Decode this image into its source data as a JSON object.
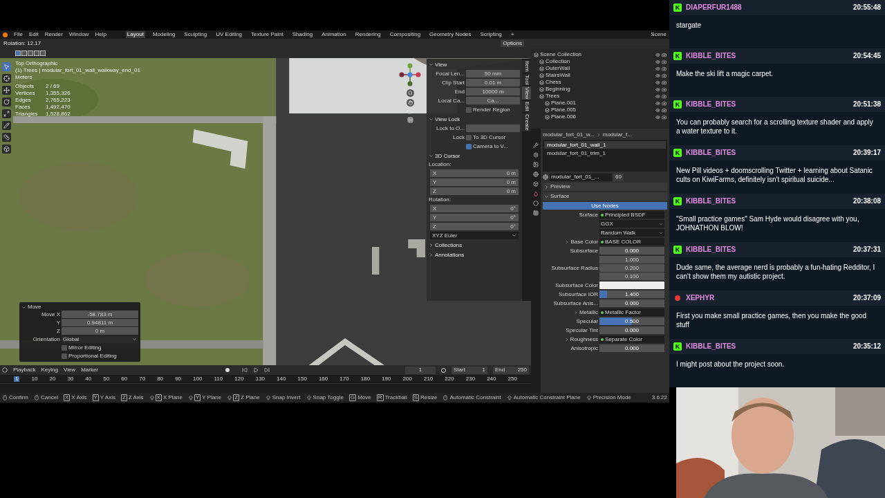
{
  "menu": [
    "File",
    "Edit",
    "Render",
    "Window",
    "Help"
  ],
  "workspaces": [
    {
      "label": "Layout",
      "selected": true
    },
    {
      "label": "Modeling",
      "selected": false
    },
    {
      "label": "Sculpting",
      "selected": false
    },
    {
      "label": "UV Editing",
      "selected": false
    },
    {
      "label": "Texture Paint",
      "selected": false
    },
    {
      "label": "Shading",
      "selected": false
    },
    {
      "label": "Animation",
      "selected": false
    },
    {
      "label": "Rendering",
      "selected": false
    },
    {
      "label": "Compositing",
      "selected": false
    },
    {
      "label": "Geometry Nodes",
      "selected": false
    },
    {
      "label": "Scripting",
      "selected": false
    },
    {
      "label": "+",
      "selected": false
    }
  ],
  "scene": "Scene",
  "header": {
    "status": "Rotation: 12.17",
    "options": "Options"
  },
  "viewport": {
    "overlay_lines": [
      "Top Orthographic",
      "(1) Trees | modular_fort_01_wall_walkway_end_01",
      "Meters"
    ],
    "stats": [
      {
        "label": "Objects",
        "value": "2 / 69"
      },
      {
        "label": "Vertices",
        "value": "1,355,326"
      },
      {
        "label": "Edges",
        "value": "2,765,223"
      },
      {
        "label": "Faces",
        "value": "1,492,470"
      },
      {
        "label": "Triangles",
        "value": "1,528,862"
      }
    ]
  },
  "move_panel": {
    "title": "Move",
    "fields": [
      {
        "label": "Move X",
        "value": "-58.783 m"
      },
      {
        "label": "Y",
        "value": "0.94811 m"
      },
      {
        "label": "Z",
        "value": "0 m"
      }
    ],
    "orientation_label": "Orientation",
    "orientation": "Global",
    "checks": [
      {
        "label": "Mirror Editing",
        "checked": false
      },
      {
        "label": "Proportional Editing",
        "checked": false
      }
    ]
  },
  "n_panel": {
    "tabs": [
      {
        "label": "Item",
        "selected": false
      },
      {
        "label": "Tool",
        "selected": false
      },
      {
        "label": "View",
        "selected": true
      },
      {
        "label": "Edit",
        "selected": false
      },
      {
        "label": "Create",
        "selected": false
      }
    ],
    "sections": [
      {
        "title": "View",
        "expanded": true,
        "rows": [
          {
            "kind": "value",
            "label": "Focal Len...",
            "value": "50 mm"
          },
          {
            "kind": "value",
            "label": "Clip Start",
            "value": "0.01 m"
          },
          {
            "kind": "value",
            "label": "End",
            "value": "10000 m"
          },
          {
            "kind": "value",
            "label": "Local Ca...",
            "value": "Ca..."
          },
          {
            "kind": "check",
            "label": "Render Region",
            "checked": false
          }
        ]
      },
      {
        "title": "View Lock",
        "expanded": true,
        "rows": [
          {
            "kind": "value",
            "label": "Lock to O..."
          },
          {
            "kind": "check",
            "label": "To 3D Cursor",
            "prefix": "Lock",
            "checked": false
          },
          {
            "kind": "check",
            "label": "Camera to V...",
            "checked": true
          }
        ]
      },
      {
        "title": "3D Cursor",
        "expanded": true,
        "rows": [
          {
            "kind": "heading",
            "label": "Location:"
          },
          {
            "kind": "axis",
            "label": "X",
            "value": "0 m"
          },
          {
            "kind": "axis",
            "label": "Y",
            "value": "0 m"
          },
          {
            "kind": "axis",
            "label": "Z",
            "value": "0 m"
          },
          {
            "kind": "heading",
            "label": "Rotation:"
          },
          {
            "kind": "axis",
            "label": "X",
            "value": "0°"
          },
          {
            "kind": "axis",
            "label": "Y",
            "value": "0°"
          },
          {
            "kind": "axis",
            "label": "Z",
            "value": "0°"
          },
          {
            "kind": "dropdown",
            "label": "XYZ Euler"
          }
        ]
      },
      {
        "title": "Collections",
        "expanded": false
      },
      {
        "title": "Annotations",
        "expanded": false
      }
    ]
  },
  "timeline": {
    "menus": [
      "Playback",
      "Keying",
      "View",
      "Marker"
    ],
    "current_frame": "1",
    "start_label": "Start",
    "start": "1",
    "end_label": "End",
    "end": "250",
    "ticks": [
      "1",
      "10",
      "20",
      "30",
      "40",
      "50",
      "60",
      "70",
      "80",
      "90",
      "100",
      "110",
      "120",
      "130",
      "140",
      "150",
      "160",
      "170",
      "180",
      "190",
      "200",
      "210",
      "220",
      "230",
      "240",
      "250"
    ]
  },
  "status_bar": {
    "hints": [
      {
        "kind": "mouse",
        "label": "Confirm"
      },
      {
        "kind": "mouse",
        "label": "Cancel"
      },
      {
        "kind": "key",
        "key": "X",
        "label": "X Axis"
      },
      {
        "kind": "key",
        "key": "Y",
        "label": "Y Axis"
      },
      {
        "kind": "key",
        "key": "Z",
        "label": "Z Axis"
      },
      {
        "kind": "shift-key",
        "key": "X",
        "label": "X Plane"
      },
      {
        "kind": "shift-key",
        "key": "Y",
        "label": "Y Plane"
      },
      {
        "kind": "shift-key",
        "key": "Z",
        "label": "Z Plane"
      },
      {
        "kind": "mod",
        "label": "Snap Invert"
      },
      {
        "kind": "mod",
        "label": "Snap Toggle"
      },
      {
        "kind": "key",
        "key": "G",
        "label": "Move"
      },
      {
        "kind": "key",
        "key": "R",
        "label": "Trackball"
      },
      {
        "kind": "key",
        "key": "S",
        "label": "Resize"
      },
      {
        "kind": "mouse",
        "label": "Automatic Constraint"
      },
      {
        "kind": "mod",
        "label": "Automatic Constraint Plane"
      },
      {
        "kind": "mod",
        "label": "Precision Mode"
      }
    ],
    "version": "3.6.22"
  },
  "outliner": {
    "tree": [
      {
        "label": "Scene Collection",
        "children": [
          {
            "label": "Collection"
          },
          {
            "label": "OuterWall"
          },
          {
            "label": "StairsWall"
          },
          {
            "label": "Chess"
          },
          {
            "label": "Beginning"
          },
          {
            "label": "Trees",
            "children": [
              {
                "label": "Plane.001"
              },
              {
                "label": "Plane.005"
              },
              {
                "label": "Plane.006"
              }
            ]
          }
        ]
      }
    ]
  },
  "properties": {
    "breadcrumb": [
      "modular_fort_01_w...",
      "modular_f..."
    ],
    "slots": [
      {
        "label": "modular_fort_01_wall_1",
        "selected": true
      },
      {
        "label": "modular_fort_01_trim_1",
        "selected": false
      }
    ],
    "material": "modular_fort_01_...",
    "users": "60",
    "sections": [
      {
        "title": "Preview",
        "expanded": false
      },
      {
        "title": "Surface",
        "expanded": true
      }
    ],
    "use_nodes": "Use Nodes",
    "rows": [
      {
        "kind": "link",
        "label": "Surface",
        "value": "Principled BSDF"
      },
      {
        "kind": "dropdown",
        "value": "GGX"
      },
      {
        "kind": "dropdown",
        "value": "Random Walk"
      },
      {
        "kind": "link",
        "label": "Base Color",
        "value": "BASE COLOR",
        "expandable": true
      },
      {
        "kind": "number",
        "label": "Subsurface",
        "value": "0.000"
      },
      {
        "kind": "vector",
        "label": "Subsurface Radius",
        "values": [
          "1.000",
          "0.200",
          "0.100"
        ]
      },
      {
        "kind": "color",
        "label": "Subsurface Color",
        "color": "#eeeeee"
      },
      {
        "kind": "number",
        "label": "Subsurface IOR",
        "value": "1.400",
        "level": 0.12
      },
      {
        "kind": "number",
        "label": "Subsurface Anis...",
        "value": "0.000"
      },
      {
        "kind": "link",
        "label": "Metallic",
        "value": "Metallic Factor",
        "expandable": true
      },
      {
        "kind": "number",
        "label": "Specular",
        "value": "0.500",
        "level": 0.5
      },
      {
        "kind": "number",
        "label": "Specular Tint",
        "value": "0.000"
      },
      {
        "kind": "link",
        "label": "Roughness",
        "value": "Separate Color",
        "expandable": true
      },
      {
        "kind": "number",
        "label": "Anisotropic",
        "value": "0.000"
      }
    ]
  },
  "chat": [
    {
      "user": "DIAPERFUR1488",
      "time": "20:55:48",
      "text": "stargate",
      "kind": "kick",
      "badge": "K",
      "color": "#53fc18"
    },
    {
      "user": "KIBBLE_BITES",
      "time": "20:54:45",
      "text": "Make the ski lift a magic carpet.",
      "kind": "kick",
      "badge": "K",
      "color": "#53fc18"
    },
    {
      "user": "KIBBLE_BITES",
      "time": "20:51:38",
      "text": "You can probably search for a scrolling texture shader and apply a water texture to it.",
      "kind": "kick",
      "badge": "K",
      "color": "#53fc18"
    },
    {
      "user": "KIBBLE_BITES",
      "time": "20:39:17",
      "text": "New Pill videos + doomscrolling Twitter + learning about Satanic cults on KiwiFarms, definitely isn't spiritual suicide...",
      "kind": "kick",
      "badge": "K",
      "color": "#53fc18"
    },
    {
      "user": "KIBBLE_BITES",
      "time": "20:38:08",
      "text": "\"Small practice games\" Sam Hyde would disagree with you, JOHNATHON BLOW!",
      "kind": "kick",
      "badge": "K",
      "color": "#53fc18"
    },
    {
      "user": "KIBBLE_BITES",
      "time": "20:37:31",
      "text": "Dude same, the average nerd is probably a fun-hating Redditor, I can't show them my autistic project.",
      "kind": "kick",
      "badge": "K",
      "color": "#53fc18"
    },
    {
      "user": "XEPHYR",
      "time": "20:37:09",
      "text": "First you make small practice games, then you make the good stuff",
      "kind": "dot",
      "color": "#e53935"
    },
    {
      "user": "KIBBLE_BITES",
      "time": "20:35:12",
      "text": "I might post about the project soon.",
      "kind": "kick",
      "badge": "K",
      "color": "#53fc18"
    }
  ]
}
